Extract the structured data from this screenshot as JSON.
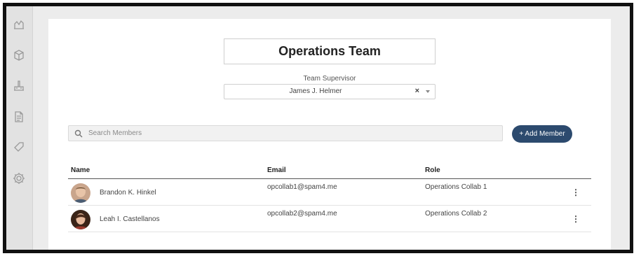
{
  "sidebar": {
    "icons": [
      {
        "name": "reports-icon"
      },
      {
        "name": "box-icon"
      },
      {
        "name": "factory-icon"
      },
      {
        "name": "document-icon"
      },
      {
        "name": "tag-icon"
      },
      {
        "name": "gear-icon"
      }
    ]
  },
  "team": {
    "title": "Operations Team",
    "supervisor_label": "Team Supervisor",
    "supervisor_value": "James J. Helmer",
    "clear_symbol": "×"
  },
  "search": {
    "placeholder": "Search Members",
    "value": ""
  },
  "add_member": {
    "label": "+ Add Member"
  },
  "table": {
    "columns": [
      "Name",
      "Email",
      "Role"
    ],
    "rows": [
      {
        "name": "Brandon K. Hinkel",
        "email": "opcollab1@spam4.me",
        "role": "Operations Collab 1",
        "menu": "⋮"
      },
      {
        "name": "Leah I. Castellanos",
        "email": "opcollab2@spam4.me",
        "role": "Operations Collab 2",
        "menu": "⋮"
      }
    ]
  },
  "colors": {
    "accent": "#2c4a6e",
    "frame": "#111111",
    "sidebar_bg": "#e2e2e2"
  }
}
